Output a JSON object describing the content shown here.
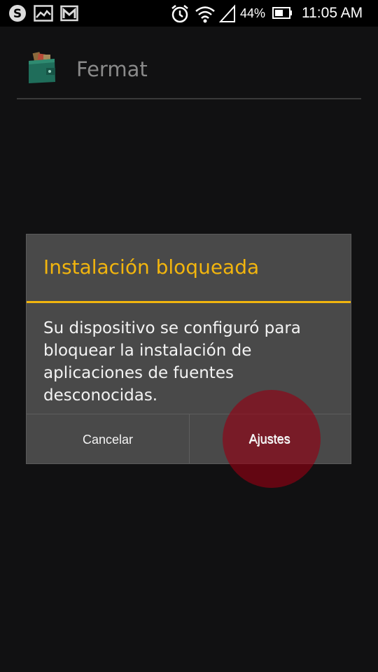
{
  "status_bar": {
    "notification_icons": [
      "skype-icon",
      "gallery-icon",
      "gmail-icon"
    ],
    "system_icons": [
      "alarm-icon",
      "wifi-icon",
      "signal-icon",
      "battery-icon"
    ],
    "battery_percent": "44%",
    "time": "11:05 AM"
  },
  "action_bar": {
    "app_icon": "wallet-icon",
    "title": "Fermat"
  },
  "dialog": {
    "title": "Instalación bloqueada",
    "message": "Su dispositivo se configuró para bloquear la instalación de aplicaciones de fuentes desconocidas.",
    "buttons": {
      "cancel": "Cancelar",
      "settings": "Ajustes"
    }
  },
  "colors": {
    "accent": "#f2b50e",
    "dialog_bg": "#494949",
    "background": "#111112",
    "touch_feedback": "#96001e"
  }
}
